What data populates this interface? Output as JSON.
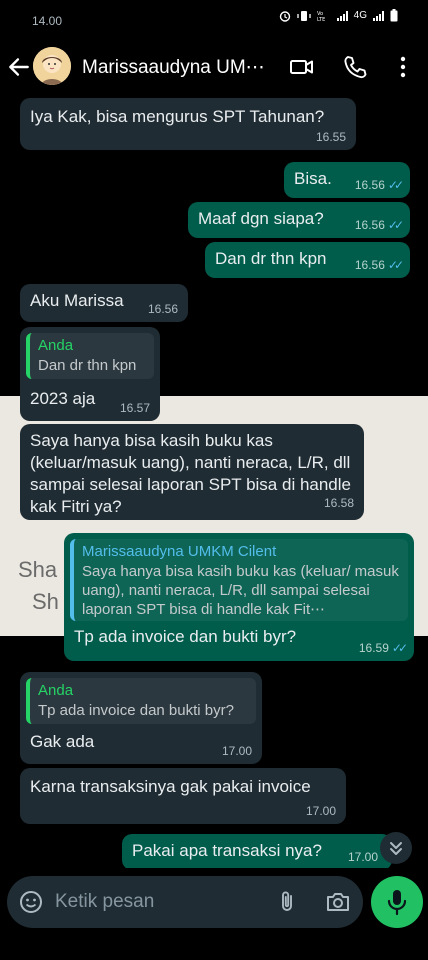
{
  "status": {
    "time": "14.00",
    "network": "4G"
  },
  "header": {
    "contact_name": "Marissaaudyna UM⋯"
  },
  "messages": [
    {
      "text": "Iya Kak, bisa mengurus SPT Tahunan?",
      "time": "16.55"
    },
    {
      "text": "Bisa.",
      "time": "16.56"
    },
    {
      "text": "Maaf dgn siapa?",
      "time": "16.56"
    },
    {
      "text": "Dan dr thn kpn",
      "time": "16.56"
    },
    {
      "text": "Aku Marissa",
      "time": "16.56"
    },
    {
      "quote_name": "Anda",
      "quote_text": "Dan dr thn kpn",
      "text": "2023 aja",
      "time": "16.57"
    },
    {
      "text": "Saya hanya bisa kasih buku kas (keluar/masuk uang), nanti neraca, L/R, dll sampai selesai laporan SPT bisa di handle kak Fitri ya?",
      "time": "16.58"
    },
    {
      "quote_name": "Marissaaudyna UMKM Cilent",
      "quote_text": "Saya hanya bisa kasih buku kas (keluar/ masuk uang), nanti neraca, L/R, dll sampai selesai laporan SPT bisa di handle kak Fit⋯",
      "text": "Tp ada invoice dan bukti byr?",
      "time": "16.59"
    },
    {
      "quote_name": "Anda",
      "quote_text": "Tp ada invoice dan bukti byr?",
      "text": "Gak ada",
      "time": "17.00"
    },
    {
      "text": "Karna transaksinya gak pakai invoice",
      "time": "17.00"
    },
    {
      "text": "Pakai apa transaksi nya?",
      "time": "17.00"
    }
  ],
  "background_text": [
    "Sha",
    "Sh"
  ],
  "input": {
    "placeholder": "Ketik pesan"
  },
  "colors": {
    "incoming": "#1f2c33",
    "outgoing": "#005c4b",
    "accent": "#25d366",
    "read_ticks": "#53bdeb",
    "mic": "#21c063"
  },
  "icons": [
    "back-arrow-icon",
    "video-call-icon",
    "voice-call-icon",
    "more-options-icon",
    "emoji-icon",
    "attach-icon",
    "camera-icon",
    "mic-icon",
    "scroll-down-icon"
  ]
}
